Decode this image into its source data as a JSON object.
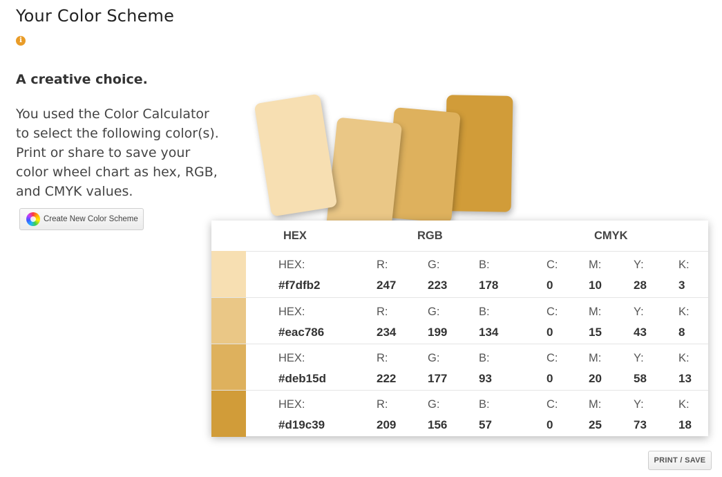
{
  "header": {
    "title": "Your Color Scheme",
    "info_icon": "info-icon"
  },
  "intro": {
    "subtitle": "A creative choice.",
    "description": "You used the Color Calculator to select the following color(s). Print or share to save your color wheel chart as hex, RGB, and CMYK values.",
    "create_button_label": "Create New Color Scheme",
    "create_button_icon": "color-wheel-icon"
  },
  "table": {
    "headers": {
      "hex": "HEX",
      "rgb": "RGB",
      "cmyk": "CMYK"
    },
    "labels": {
      "hex": "HEX:",
      "r": "R:",
      "g": "G:",
      "b": "B:",
      "c": "C:",
      "m": "M:",
      "y": "Y:",
      "k": "K:"
    },
    "rows": [
      {
        "color": "#f7dfb2",
        "hex": "#f7dfb2",
        "r": "247",
        "g": "223",
        "b": "178",
        "c": "0",
        "m": "10",
        "y": "28",
        "k": "3"
      },
      {
        "color": "#eac786",
        "hex": "#eac786",
        "r": "234",
        "g": "199",
        "b": "134",
        "c": "0",
        "m": "15",
        "y": "43",
        "k": "8"
      },
      {
        "color": "#deb15d",
        "hex": "#deb15d",
        "r": "222",
        "g": "177",
        "b": "93",
        "c": "0",
        "m": "20",
        "y": "58",
        "k": "13"
      },
      {
        "color": "#d19c39",
        "hex": "#d19c39",
        "r": "209",
        "g": "156",
        "b": "57",
        "c": "0",
        "m": "25",
        "y": "73",
        "k": "18"
      }
    ]
  },
  "actions": {
    "print_label": "PRINT / SAVE"
  },
  "colors": {
    "accent": "#e99c28"
  }
}
